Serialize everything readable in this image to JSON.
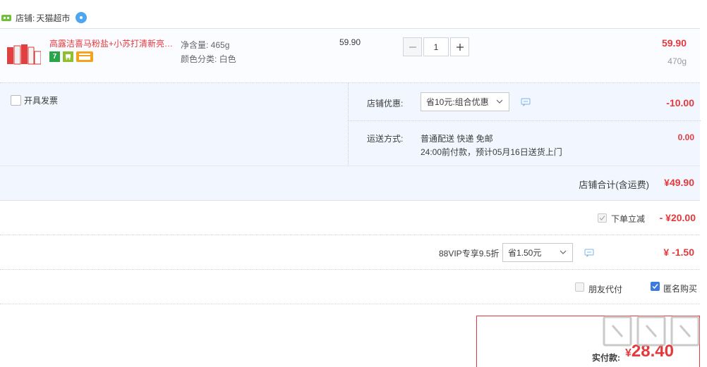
{
  "store": {
    "label": "店铺:",
    "name": "天猫超市"
  },
  "item": {
    "title": "高露洁喜马粉盐+小苏打清新亮…",
    "attr_net": "净含量: 465g",
    "attr_color": "颜色分类: 白色",
    "unit_price": "59.90",
    "quantity": "1",
    "line_total": "59.90",
    "weight": "470g",
    "badge_seven": "7"
  },
  "options": {
    "invoice_label": "开具发票",
    "discount_label": "店铺优惠:",
    "discount_value": "省10元:组合优惠",
    "discount_amount": "-10.00",
    "ship_label": "运送方式:",
    "ship_line1": "普通配送 快递 免邮",
    "ship_line2": "24:00前付款，预计05月16日送货上门",
    "ship_fee": "0.00"
  },
  "store_total": {
    "label": "店铺合计(含运费)",
    "amount": "¥49.90"
  },
  "instant": {
    "label": "下单立减",
    "amount": "- ¥20.00"
  },
  "vip": {
    "label": "88VIP专享9.5折",
    "select_value": "省1.50元",
    "amount": "¥ -1.50"
  },
  "order_options": {
    "friend_pay": "朋友代付",
    "anonymous": "匿名购买"
  },
  "pay": {
    "label": "实付款:",
    "currency": "¥",
    "amount": "28.40"
  },
  "colors": {
    "accent_red": "#e4393c",
    "panel_blue": "#f2f7ff",
    "check_blue": "#3b7be0"
  }
}
